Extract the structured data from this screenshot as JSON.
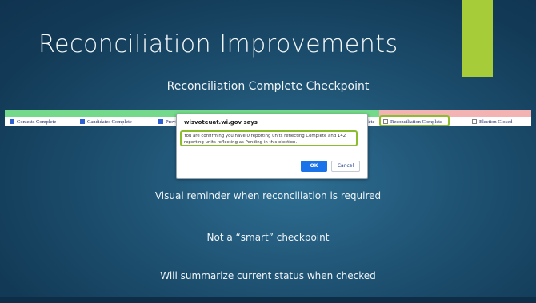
{
  "slide": {
    "title": "Reconciliation Improvements",
    "subtitle": "Reconciliation Complete Checkpoint",
    "accent_color": "#a6cd39"
  },
  "checkpoints": {
    "items": [
      {
        "label": "Contests Complete",
        "checked": true
      },
      {
        "label": "Candidates Complete",
        "checked": true
      },
      {
        "label": "Provi",
        "checked": true
      },
      {
        "label": "lete",
        "checked": false
      },
      {
        "label": "Reconciliation Complete",
        "checked": false
      },
      {
        "label": "Election Closed",
        "checked": false
      }
    ],
    "complete_color": "#74d98a",
    "pending_color": "#f3b3b3"
  },
  "dialog": {
    "title": "wisvoteuat.wi.gov says",
    "message": "You are confirming you have 0 reporting units reflecting Complete and 142 reporting units reflecting as Pending in this election.",
    "ok_label": "OK",
    "cancel_label": "Cancel"
  },
  "points": [
    "Visual reminder when reconciliation is required",
    "Not a “smart” checkpoint",
    "Will summarize current status when checked"
  ]
}
